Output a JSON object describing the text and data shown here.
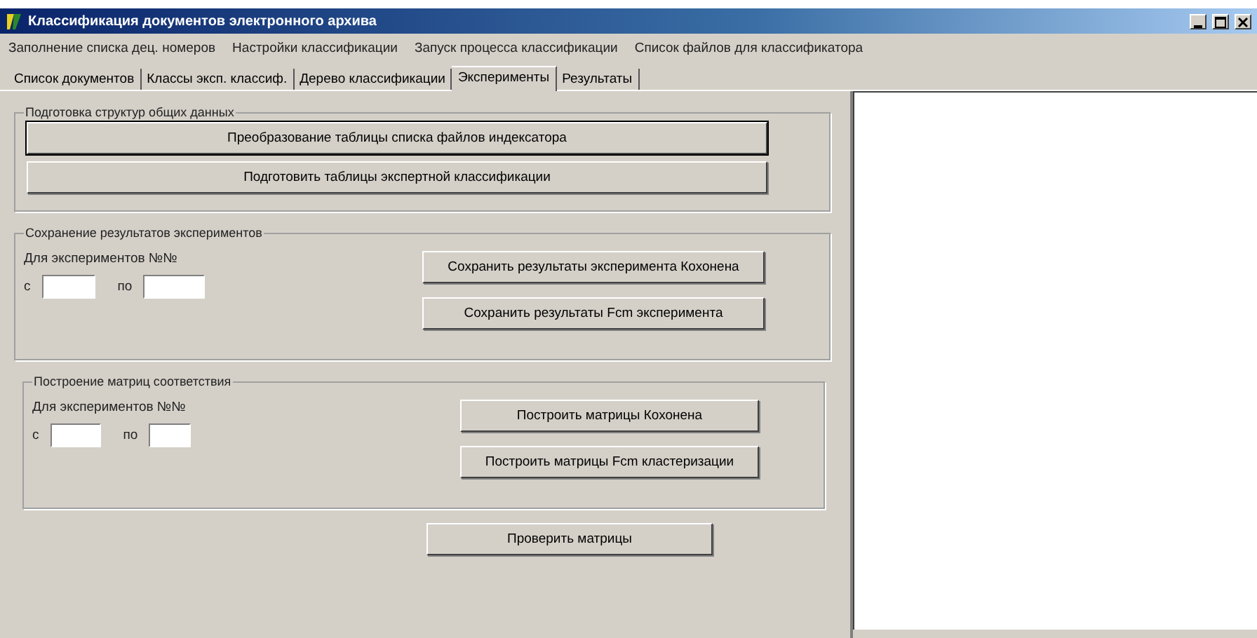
{
  "window": {
    "title": "Классификация документов электронного архива"
  },
  "menu": [
    "Заполнение списка дец. номеров",
    "Настройки классификации",
    "Запуск процесса классификации",
    "Список файлов для классификатора"
  ],
  "tabs": [
    {
      "label": "Список документов",
      "selected": false
    },
    {
      "label": "Классы эксп. классиф.",
      "selected": false
    },
    {
      "label": "Дерево классификации",
      "selected": false
    },
    {
      "label": "Эксперименты",
      "selected": true
    },
    {
      "label": "Результаты",
      "selected": false
    }
  ],
  "prepare_group": {
    "title": "Подготовка структур общих данных",
    "buttons": [
      {
        "label": "Преобразование таблицы списка файлов индексатора",
        "focused": true
      },
      {
        "label": "Подготовить таблицы экспертной классификации",
        "focused": false
      }
    ]
  },
  "save_group": {
    "title": "Сохранение результатов экспериментов",
    "range_label": "Для экспериментов №№",
    "from_label": "с",
    "to_label": "по",
    "buttons": [
      {
        "label": "Сохранить результаты эксперимента Кохонена",
        "focused": false
      },
      {
        "label": "Сохранить результаты Fcm эксперимента",
        "focused": false
      }
    ]
  },
  "matrix_group": {
    "title": "Построение матриц соответствия",
    "range_label": "Для экспериментов №№",
    "from_label": "с",
    "to_label": "по",
    "buttons": [
      {
        "label": "Построить матрицы Кохонена",
        "focused": false
      },
      {
        "label": "Построить матрицы Fcm кластеризации",
        "focused": false
      }
    ]
  },
  "check_button": {
    "label": "Проверить матрицы",
    "focused": false
  }
}
